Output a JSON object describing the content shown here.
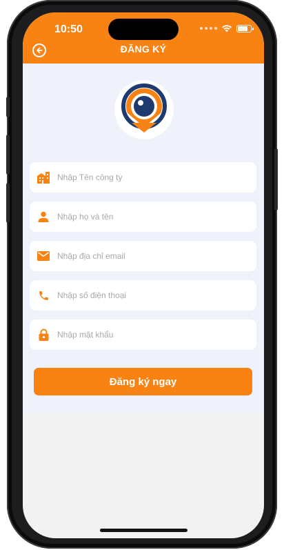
{
  "status_bar": {
    "time": "10:50",
    "battery_level": 0.85
  },
  "header": {
    "title": "ĐĂNG KÝ",
    "back_icon": "back-arrow-circle-icon"
  },
  "logo": {
    "icon": "eye-location-pin-logo",
    "colors": {
      "ring": "#1e3a6e",
      "accent": "#f98312"
    }
  },
  "form": {
    "fields": [
      {
        "icon": "building-icon",
        "placeholder": "Nhập Tên công ty",
        "value": ""
      },
      {
        "icon": "person-icon",
        "placeholder": "Nhập họ và tên",
        "value": ""
      },
      {
        "icon": "email-icon",
        "placeholder": "Nhập địa chỉ email",
        "value": ""
      },
      {
        "icon": "phone-icon",
        "placeholder": "Nhập số điện thoại",
        "value": ""
      },
      {
        "icon": "lock-icon",
        "placeholder": "Nhập mật khẩu",
        "value": ""
      }
    ],
    "submit_label": "Đăng ký ngay"
  },
  "colors": {
    "accent": "#f98312",
    "content_bg": "#eff1fb",
    "field_bg": "#ffffff"
  }
}
